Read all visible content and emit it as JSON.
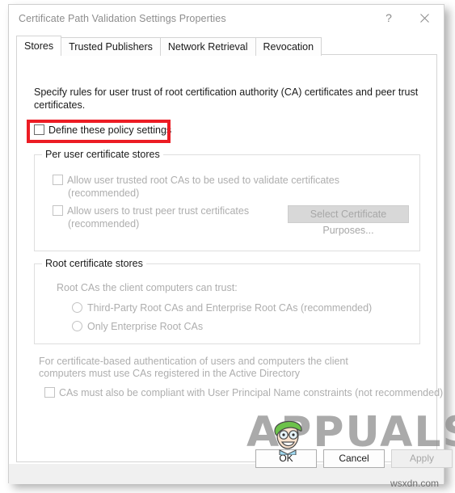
{
  "window": {
    "title": "Certificate Path Validation Settings Properties",
    "help_icon": "question-mark-icon",
    "close_icon": "close-icon"
  },
  "tabs": [
    {
      "label": "Stores",
      "active": true
    },
    {
      "label": "Trusted Publishers",
      "active": false
    },
    {
      "label": "Network Retrieval",
      "active": false
    },
    {
      "label": "Revocation",
      "active": false
    }
  ],
  "stores_tab": {
    "intro": "Specify rules for user trust of root certification authority (CA) certificates and peer trust certificates.",
    "define_policy": {
      "label": "Define these policy settings",
      "checked": false,
      "highlighted": true,
      "highlight_color": "#ec1c24"
    },
    "per_user_group": {
      "title": "Per user certificate stores",
      "checkbox_1": {
        "label": "Allow user trusted root CAs to be used to validate certificates",
        "sublabel": "(recommended)",
        "checked": false,
        "disabled": true
      },
      "checkbox_2": {
        "label": "Allow users to trust peer trust certificates",
        "sublabel": "(recommended)",
        "checked": false,
        "disabled": true
      },
      "select_purposes_button": {
        "label": "Select Certificate Purposes...",
        "disabled": true
      }
    },
    "root_group": {
      "title": "Root certificate stores",
      "prompt": "Root CAs the client computers can trust:",
      "options": [
        {
          "label": "Third-Party Root CAs and Enterprise Root CAs (recommended)",
          "selected": false,
          "disabled": true
        },
        {
          "label": "Only Enterprise Root CAs",
          "selected": false,
          "disabled": true
        }
      ]
    },
    "footnote_line1": "For certificate-based authentication of users and computers the client",
    "footnote_line2": "computers must use CAs registered in the Active Directory",
    "upn_checkbox": {
      "label": "CAs must also be compliant with User Principal Name constraints (not recommended)",
      "checked": false,
      "disabled": true
    }
  },
  "buttons": {
    "ok": {
      "label": "OK",
      "disabled": false
    },
    "cancel": {
      "label": "Cancel",
      "disabled": false
    },
    "apply": {
      "label": "Apply",
      "disabled": true
    }
  },
  "watermark": {
    "brand": "APPUALS",
    "source": "wsxdn.com"
  }
}
